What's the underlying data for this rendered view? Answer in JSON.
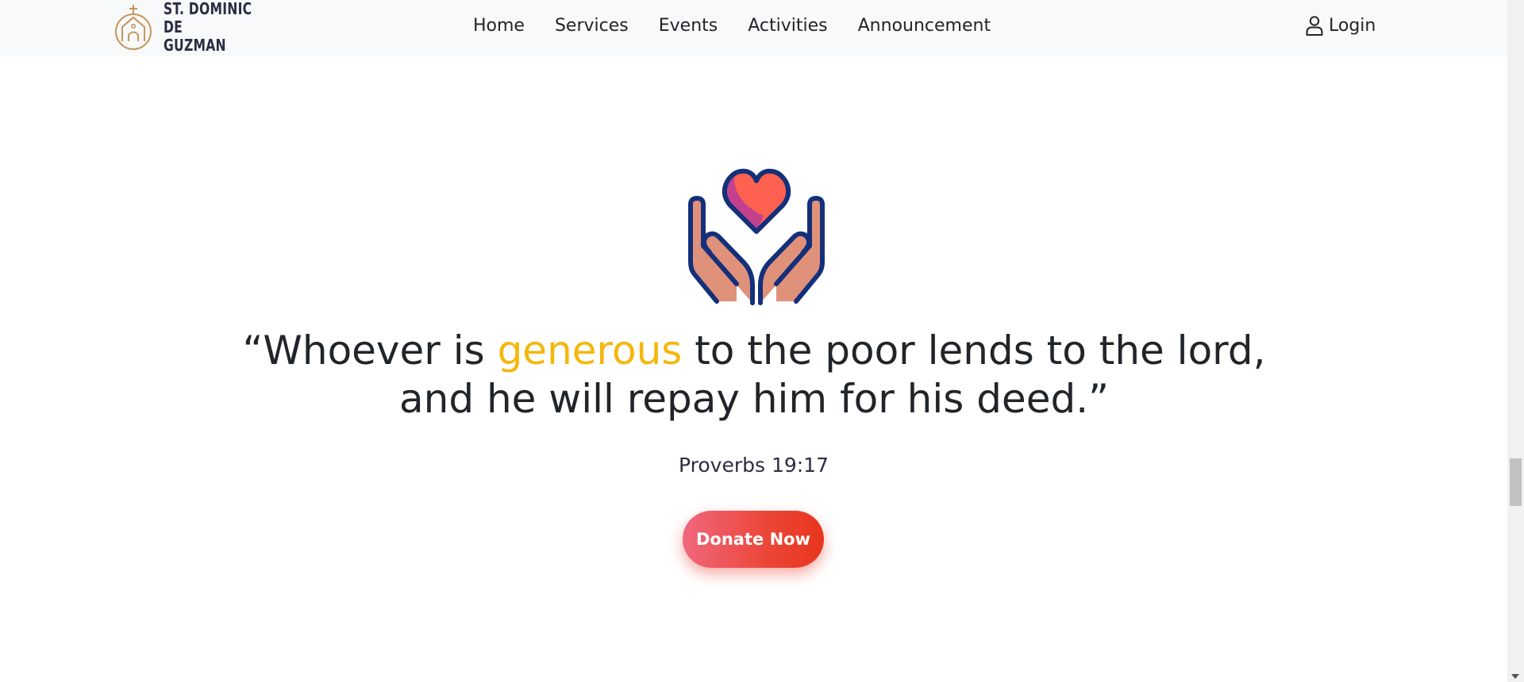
{
  "header": {
    "brand_line1": "ST. DOMINIC DE",
    "brand_line2": "GUZMAN",
    "nav": [
      "Home",
      "Services",
      "Events",
      "Activities",
      "Announcement"
    ],
    "login_label": "Login"
  },
  "hero": {
    "quote_open": "“Whoever is ",
    "quote_highlight": "generous",
    "quote_rest_line1": " to the poor lends to the lord,",
    "quote_line2": "and he will repay him for his deed.”",
    "verse": "Proverbs 19:17",
    "cta_label": "Donate Now"
  },
  "colors": {
    "highlight": "#f5b70c",
    "cta_gradient_start": "#f0677d",
    "cta_gradient_end": "#e8351e",
    "brand_logo": "#c8955a"
  },
  "icons": {
    "brand": "church-icon",
    "login": "user-icon",
    "hero": "hands-heart-icon"
  }
}
